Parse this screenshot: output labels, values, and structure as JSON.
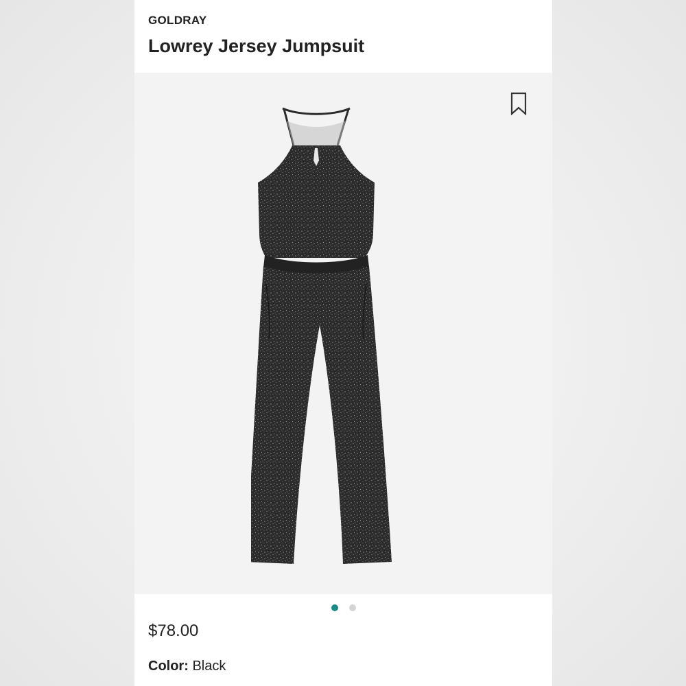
{
  "product": {
    "brand": "GOLDRAY",
    "title": "Lowrey Jersey Jumpsuit",
    "price": "$78.00",
    "color_label": "Color:",
    "color_value": "Black"
  },
  "gallery": {
    "current_index": 1,
    "total": 2
  },
  "colors": {
    "accent": "#1c8a87",
    "garment": "#2b2b2b",
    "image_bg": "#f3f3f3"
  },
  "icons": {
    "bookmark": "bookmark-icon"
  }
}
